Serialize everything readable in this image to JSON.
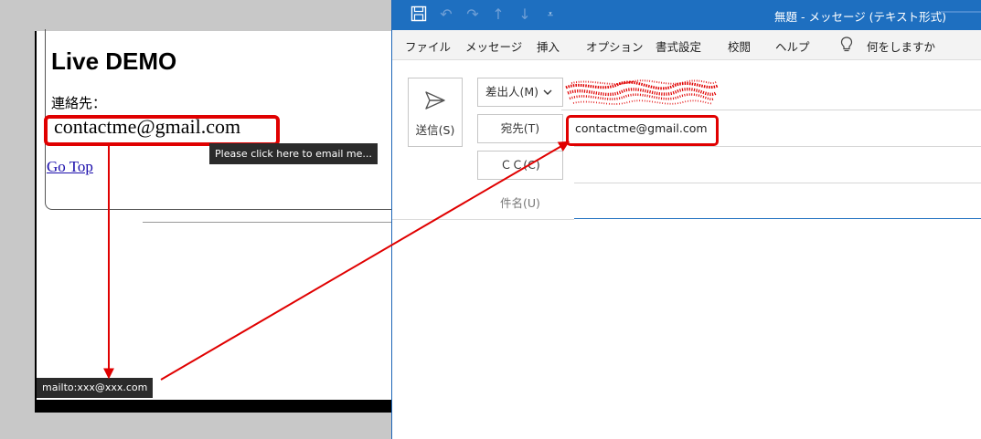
{
  "browser": {
    "heading": "Live DEMO",
    "contact_label": "連絡先：",
    "email_link_text": "contactme@gmail.com",
    "tooltip": "Please click here to email me...",
    "go_top": "Go Top",
    "status_url": "mailto:xxx@xxx.com"
  },
  "outlook": {
    "window_title": "無題  -  メッセージ (テキスト形式)",
    "quick_access_icons": [
      "save-icon",
      "undo-icon",
      "redo-icon",
      "up-arrow-icon",
      "down-arrow-icon",
      "customize-icon"
    ],
    "menu": [
      "ファイル",
      "メッセージ",
      "挿入",
      "オプション",
      "書式設定",
      "校閲",
      "ヘルプ"
    ],
    "tell_me": "何をしますか",
    "send_button": "送信(S)",
    "from_button": "差出人(M)",
    "to_button": "宛先(T)",
    "cc_button": "ＣＣ(C)",
    "subject_label": "件名(U)",
    "to_value": "contactme@gmail.com"
  },
  "colors": {
    "titlebar": "#1e6fc0",
    "highlight": "#e00000",
    "tooltip_bg": "#2b2b2b"
  }
}
